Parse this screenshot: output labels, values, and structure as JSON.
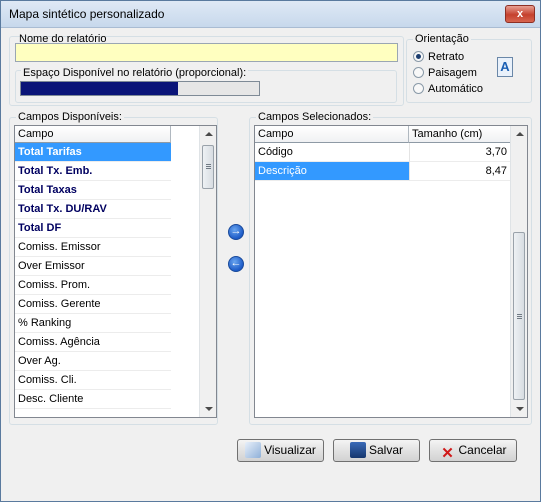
{
  "window": {
    "title": "Mapa sintético personalizado",
    "close_label": "x"
  },
  "report": {
    "name_label": "Nome do relatório",
    "name_value": "",
    "space_label": "Espaço Disponível no relatório (proporcional):",
    "space_fraction": 0.66
  },
  "orientation": {
    "label": "Orientação",
    "options": [
      "Retrato",
      "Paisagem",
      "Automático"
    ],
    "selected": "Retrato",
    "icon": "page-orientation-icon"
  },
  "available": {
    "label": "Campos Disponíveis:",
    "header": "Campo",
    "items": [
      "Total Tarifas",
      "Total Tx. Emb.",
      "Total Taxas",
      "Total Tx. DU/RAV",
      "Total DF",
      "Comiss. Emissor",
      "Over Emissor",
      "Comiss. Prom.",
      "Comiss. Gerente",
      "% Ranking",
      "Comiss. Agência",
      "Over Ag.",
      "Comiss. Cli.",
      "Desc. Cliente"
    ],
    "bold_count": 5,
    "selected_index": 0
  },
  "selected": {
    "label": "Campos Selecionados:",
    "headers": [
      "Campo",
      "Tamanho (cm)"
    ],
    "rows": [
      {
        "campo": "Código",
        "tamanho": "3,70"
      },
      {
        "campo": "Descrição",
        "tamanho": "8,47"
      }
    ],
    "selected_index": 1
  },
  "transfer": {
    "add_icon": "arrow-right-icon",
    "remove_icon": "arrow-left-icon"
  },
  "buttons": {
    "visualizar": "Visualizar",
    "salvar": "Salvar",
    "cancelar": "Cancelar"
  },
  "colors": {
    "selection": "#3399ff",
    "progress": "#0a1478",
    "input_bg": "#ffffc0"
  }
}
